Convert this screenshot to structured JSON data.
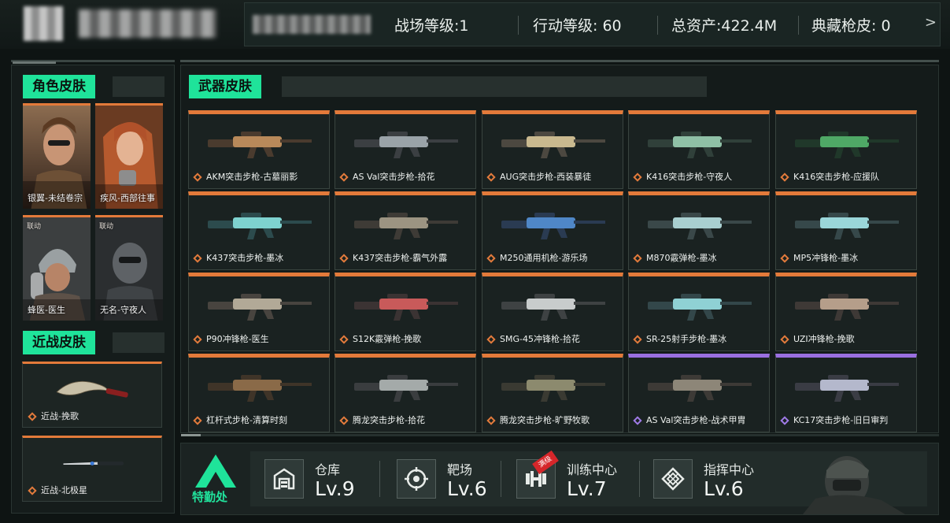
{
  "header": {
    "stats": [
      {
        "label": "战场等级",
        "value": "1",
        "text": "战场等级:1"
      },
      {
        "label": "行动等级",
        "value": "60",
        "text": "行动等级: 60"
      },
      {
        "label": "总资产",
        "value": "422.4M",
        "text": "总资产:422.4M"
      },
      {
        "label": "典藏枪皮",
        "value": "0",
        "text": "典藏枪皮: 0"
      }
    ],
    "close_icon": ">"
  },
  "left": {
    "character_section_title": "角色皮肤",
    "characters": [
      {
        "name": "银翼-未结卷宗",
        "tag": ""
      },
      {
        "name": "疾风-西部往事",
        "tag": ""
      },
      {
        "name": "蜂医-医生",
        "tag": "联动"
      },
      {
        "name": "无名-守夜人",
        "tag": "联动"
      }
    ],
    "melee_section_title": "近战皮肤",
    "melee": [
      {
        "name": "近战-挽歌"
      },
      {
        "name": "近战-北极星"
      }
    ]
  },
  "weapons": {
    "section_title": "武器皮肤",
    "items": [
      {
        "name": "AKM突击步枪-古墓丽影",
        "rarity": "orange"
      },
      {
        "name": "AS Val突击步枪-拾花",
        "rarity": "orange"
      },
      {
        "name": "AUG突击步枪-西装暴徒",
        "rarity": "orange"
      },
      {
        "name": "K416突击步枪-守夜人",
        "rarity": "orange"
      },
      {
        "name": "K416突击步枪-应援队",
        "rarity": "orange"
      },
      {
        "name": "K437突击步枪-墨冰",
        "rarity": "orange"
      },
      {
        "name": "K437突击步枪-霸气外露",
        "rarity": "orange"
      },
      {
        "name": "M250通用机枪-游乐场",
        "rarity": "orange"
      },
      {
        "name": "M870霰弹枪-墨冰",
        "rarity": "orange"
      },
      {
        "name": "MP5冲锋枪-墨冰",
        "rarity": "orange"
      },
      {
        "name": "P90冲锋枪-医生",
        "rarity": "orange"
      },
      {
        "name": "S12K霰弹枪-挽歌",
        "rarity": "orange"
      },
      {
        "name": "SMG-45冲锋枪-拾花",
        "rarity": "orange"
      },
      {
        "name": "SR-25射手步枪-墨冰",
        "rarity": "orange"
      },
      {
        "name": "UZI冲锋枪-挽歌",
        "rarity": "orange"
      },
      {
        "name": "杠杆式步枪-清算时刻",
        "rarity": "orange"
      },
      {
        "name": "腾龙突击步枪-拾花",
        "rarity": "orange"
      },
      {
        "name": "腾龙突击步枪-旷野牧歌",
        "rarity": "orange"
      },
      {
        "name": "AS Val突击步枪-战术甲胄",
        "rarity": "purple"
      },
      {
        "name": "KC17突击步枪-旧日审判",
        "rarity": "purple"
      }
    ]
  },
  "footer": {
    "hq_label": "特勤处",
    "facilities": [
      {
        "name": "仓库",
        "level": "Lv.9",
        "icon": "warehouse-icon"
      },
      {
        "name": "靶场",
        "level": "Lv.6",
        "icon": "target-icon"
      },
      {
        "name": "训练中心",
        "level": "Lv.7",
        "icon": "dumbbell-icon",
        "badge": "满级"
      },
      {
        "name": "指挥中心",
        "level": "Lv.6",
        "icon": "command-icon"
      }
    ]
  },
  "colors": {
    "accent_green": "#1fe39a",
    "rarity_orange": "#e37a3a",
    "rarity_purple": "#9a6fe0"
  }
}
